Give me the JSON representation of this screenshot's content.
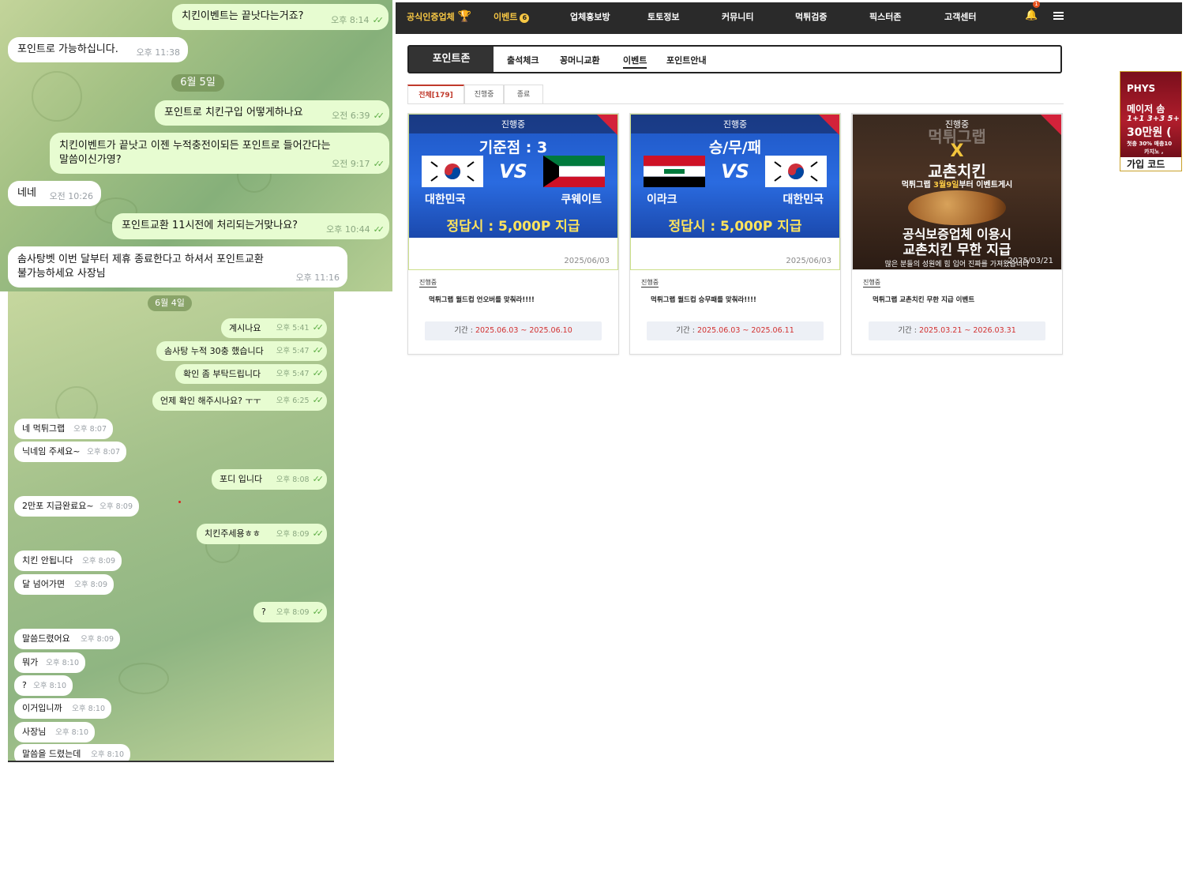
{
  "chat_top": {
    "messages": [
      {
        "dir": "out",
        "text": "치킨이벤트는 끝낫다는거죠?",
        "time": "오후 8:14"
      },
      {
        "dir": "in",
        "text": "포인트로 가능하십니다.",
        "time": "오후 11:38"
      },
      {
        "dir": "out",
        "text": "포인트로 치킨구입 어떻게하나요",
        "time": "오전 6:39"
      },
      {
        "dir": "out",
        "text": "치킨이벤트가 끝낫고 이젠 누적충전이되든 포인트로 들어간다는",
        "text2": "말씀이신가영?",
        "time": "오전 9:17"
      },
      {
        "dir": "in",
        "text": "네네",
        "time": "오전 10:26"
      },
      {
        "dir": "out",
        "text": "포인트교환 11시전에 처리되는거맞나요?",
        "time": "오후 10:44"
      },
      {
        "dir": "in",
        "text": "솜사탕벳 이번 달부터 제휴 종료한다고 하셔서 포인트교환",
        "text2": "불가능하세요 사장님",
        "time": "오후 11:16"
      }
    ],
    "date_pill": "6월 5일"
  },
  "chat_bottom": {
    "date_pill": "6월 4일",
    "messages": [
      {
        "dir": "out",
        "text": "계시나요",
        "time": "오후 5:41"
      },
      {
        "dir": "out",
        "text": "솜사탕 누적 30충 했습니다",
        "time": "오후 5:47"
      },
      {
        "dir": "out",
        "text": "확인 좀 부탁드립니다",
        "time": "오후 5:47"
      },
      {
        "dir": "out",
        "text": "언제 확인 해주시나요? ㅜㅜ",
        "time": "오후 6:25"
      },
      {
        "dir": "in",
        "text": "네 먹튀그랩",
        "time": "오후 8:07"
      },
      {
        "dir": "in",
        "text": "닉네임 주세요~",
        "time": "오후 8:07"
      },
      {
        "dir": "out",
        "text": "포디 입니다",
        "time": "오후 8:08"
      },
      {
        "dir": "in",
        "text": "2만포 지급완료요~",
        "time": "오후 8:09"
      },
      {
        "dir": "out",
        "text": "치킨주세용ㅎㅎ",
        "time": "오후 8:09"
      },
      {
        "dir": "in",
        "text": "치킨 안됩니다",
        "time": "오후 8:09"
      },
      {
        "dir": "in",
        "text": "달 넘어가면",
        "time": "오후 8:09"
      },
      {
        "dir": "out",
        "text": "?",
        "time": "오후 8:09"
      },
      {
        "dir": "in",
        "text": "말씀드렸어요",
        "time": "오후 8:09"
      },
      {
        "dir": "in",
        "text": "뭐가",
        "time": "오후 8:10"
      },
      {
        "dir": "in",
        "text": "?",
        "time": "오후 8:10"
      },
      {
        "dir": "in",
        "text": "이거입니까",
        "time": "오후 8:10"
      },
      {
        "dir": "in",
        "text": "사장님",
        "time": "오후 8:10"
      },
      {
        "dir": "in",
        "text": "말씀을 드렸는데",
        "time": "오후 8:10"
      }
    ]
  },
  "site": {
    "nav": {
      "brand": "공식인증업체",
      "items": [
        "이벤트",
        "업체홍보방",
        "토토정보",
        "커뮤니티",
        "먹튀검증",
        "픽스터존",
        "고객센터"
      ],
      "event_badge": "6",
      "bell_count": "1"
    },
    "point_zone": {
      "label": "포인트존",
      "tabs": [
        "출석체크",
        "꽁머니교환",
        "이벤트",
        "포인트안내"
      ],
      "active_tab": "이벤트"
    },
    "subtabs": [
      "전체[179]",
      "진행중",
      "종료"
    ],
    "cards": [
      {
        "status": "진행중",
        "headline": "기준점 : 3",
        "vs": "VS",
        "team_left": "대한민국",
        "team_right": "쿠웨이트",
        "prize": "정답시 : 5,000P 지급",
        "date": "2025/06/03",
        "tag": "진행중",
        "title": "먹튀그랩 월드컵 언오버를 맞춰라!!!!",
        "period_label": "기간 : ",
        "period": "2025.06.03 ~ 2025.06.10"
      },
      {
        "status": "진행중",
        "headline": "승/무/패",
        "vs": "VS",
        "team_left": "이라크",
        "team_right": "대한민국",
        "prize": "정답시 : 5,000P 지급",
        "date": "2025/06/03",
        "tag": "진행중",
        "title": "먹튀그랩 월드컵 승무패를 맞춰라!!!!",
        "period_label": "기간 : ",
        "period": "2025.06.03 ~ 2025.06.11"
      },
      {
        "status": "진행중",
        "brand": "먹튀그랩",
        "x": "X",
        "headline": "교촌치킨",
        "sub_pre": "먹튀그랩 ",
        "sub_hl": "3월9일",
        "sub_post": "부터 이벤트게시",
        "big1": "공식보증업체 이용시",
        "big2": "교촌치킨 무한 지급",
        "foot": "많은 분들의 성원에 힘 입어 진짜를 가져왔습니다",
        "date": "2025/03/21",
        "tag": "진행중",
        "title": "먹튀그랩 교촌치킨 무한 지급 이벤트",
        "period_label": "기간 : ",
        "period": "2025.03.21 ~ 2026.03.31"
      }
    ],
    "side_ad": {
      "l1": "PHYS",
      "l2": "메이저 솜",
      "l3": "1+1 3+3 5+",
      "l4": "30만원 (",
      "l5": "첫충 30% 매충10",
      "l6": "카지노 ,",
      "code": "가입 코드"
    }
  }
}
